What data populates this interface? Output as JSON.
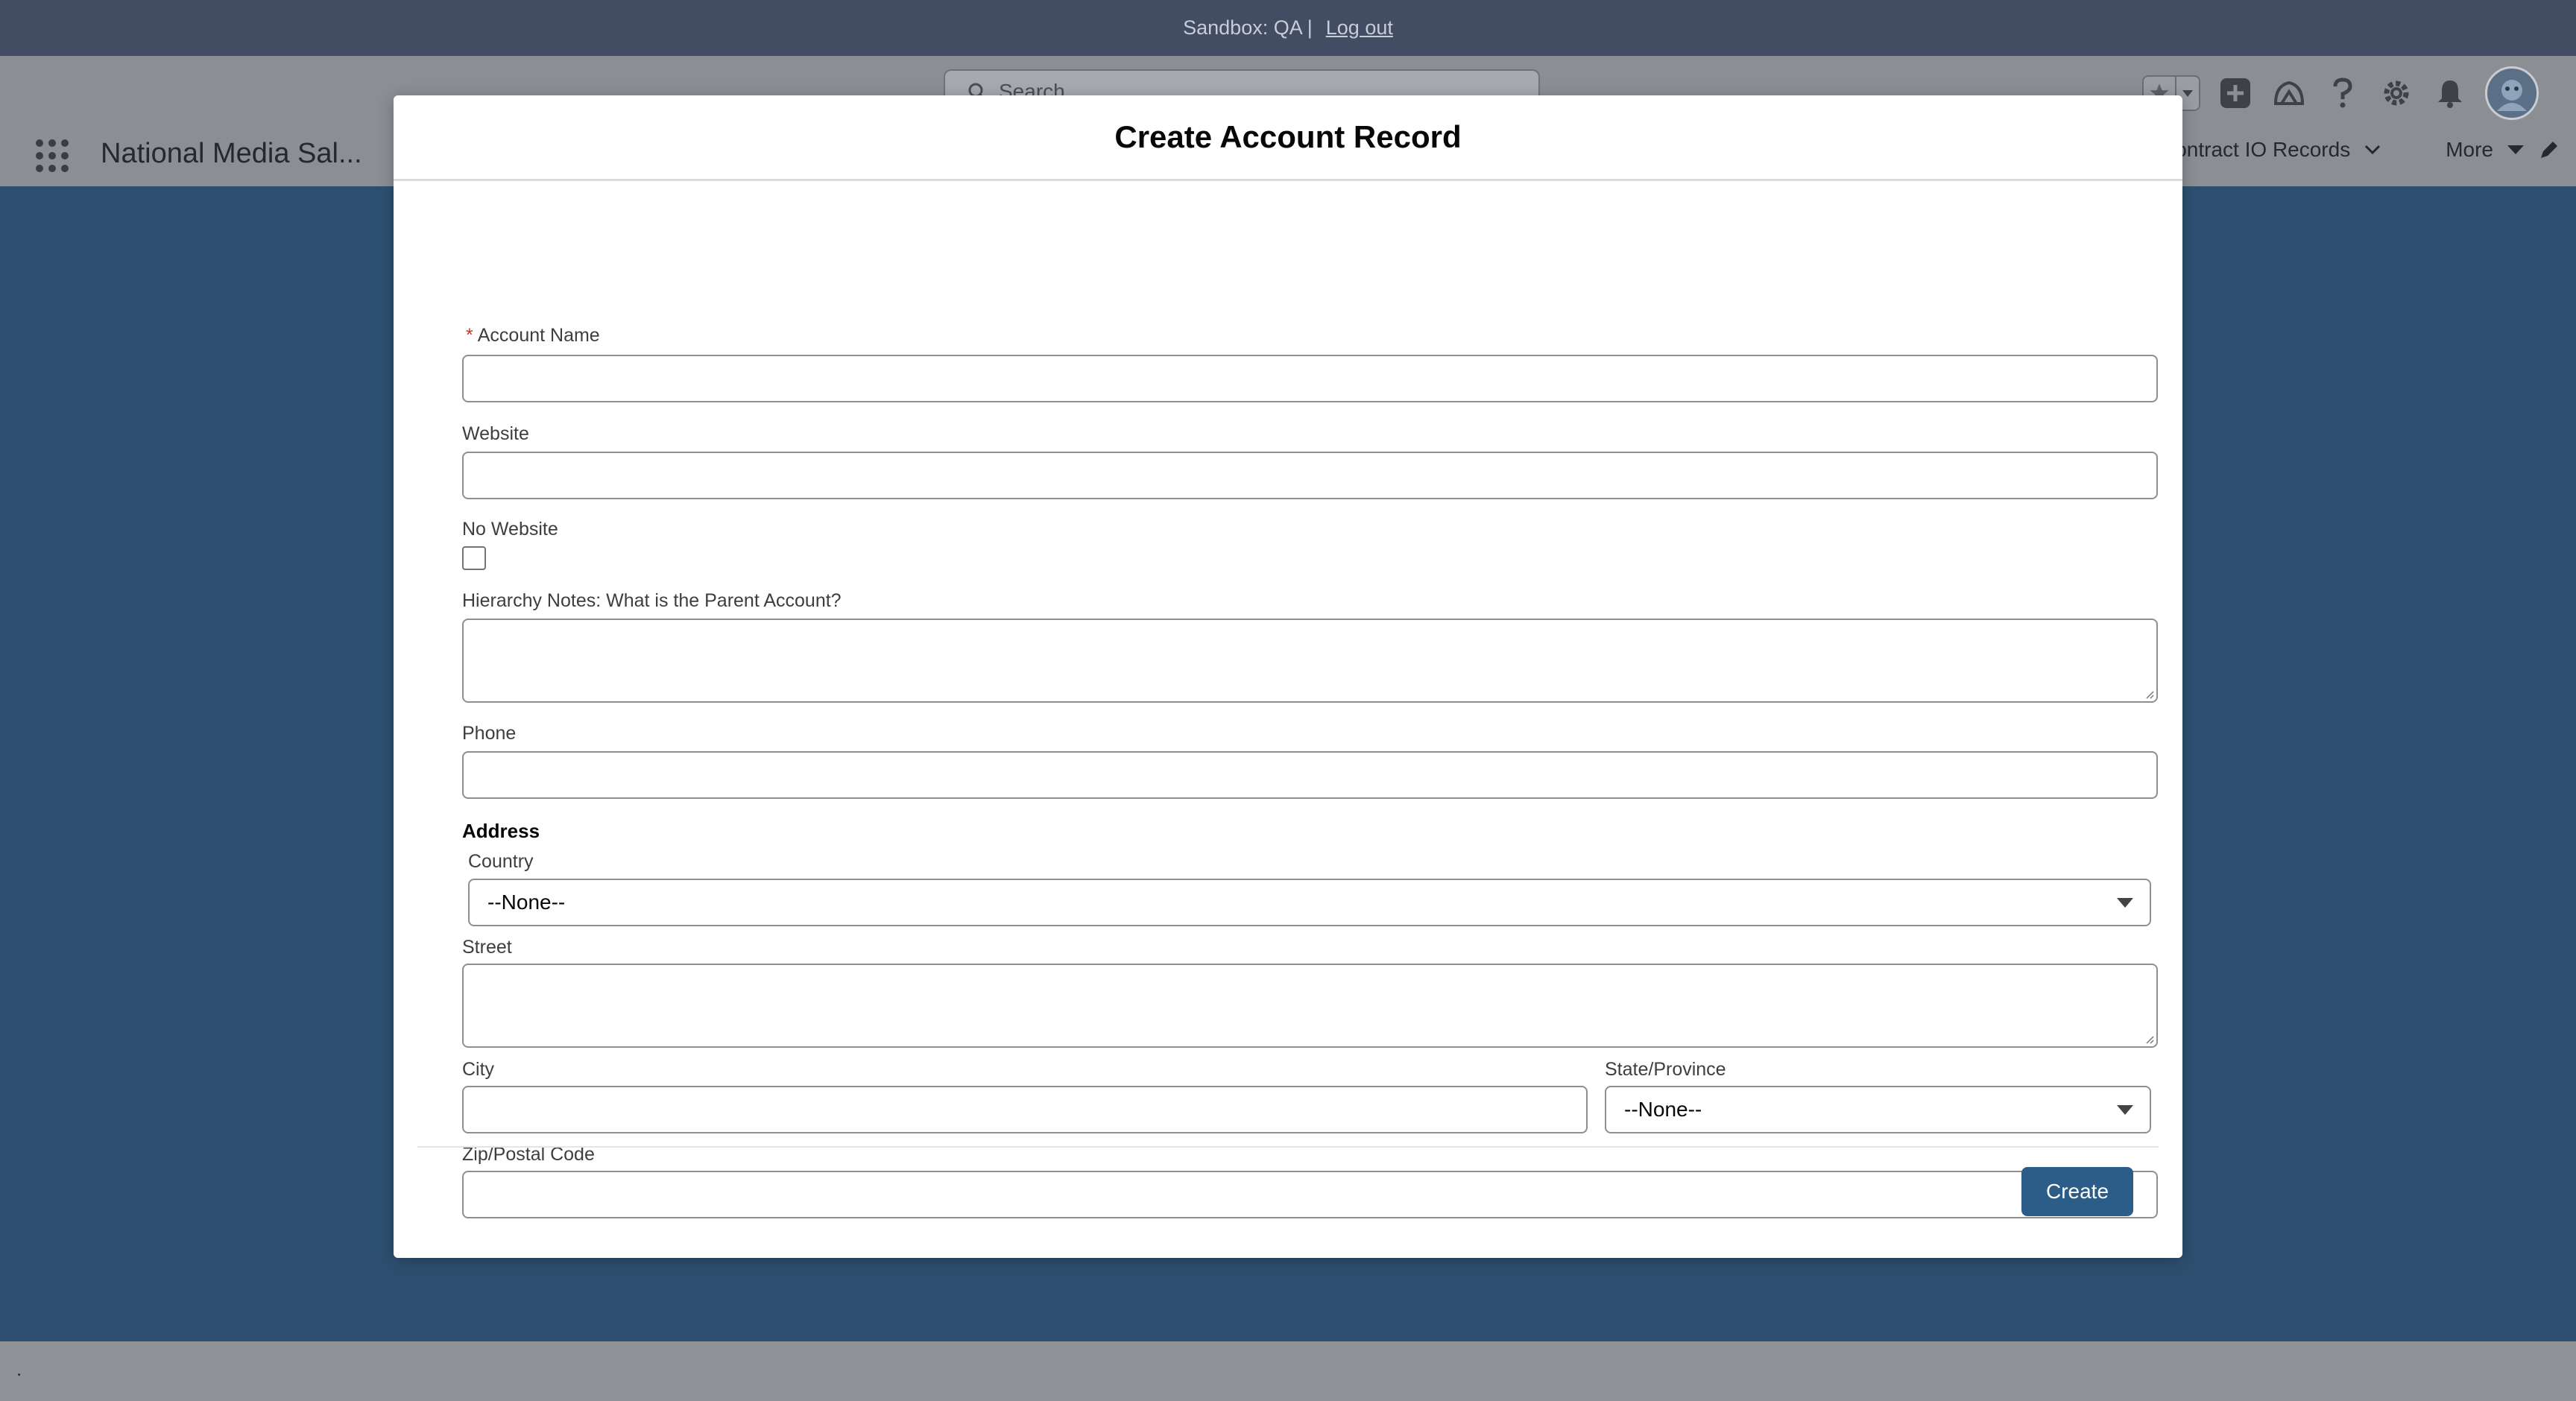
{
  "sandbox_bar": {
    "text": "Sandbox: QA |",
    "logout": "Log out"
  },
  "header": {
    "search_placeholder": "Search...",
    "icons": [
      "favorites-star-icon",
      "favorites-dropdown-icon",
      "global-actions-plus-icon",
      "trailhead-icon",
      "help-icon",
      "setup-gear-icon",
      "notifications-bell-icon",
      "user-avatar"
    ]
  },
  "nav": {
    "app_name": "National Media Sal...",
    "tab_contract": "Contract IO Records",
    "tab_more": "More"
  },
  "modal": {
    "title": "Create Account Record",
    "fields": {
      "account_name": {
        "label": "Account Name",
        "required_marker": "*",
        "value": ""
      },
      "website": {
        "label": "Website",
        "value": ""
      },
      "no_website": {
        "label": "No Website",
        "checked": false
      },
      "hierarchy_notes": {
        "label": "Hierarchy Notes: What is the Parent Account?",
        "value": ""
      },
      "phone": {
        "label": "Phone",
        "value": ""
      }
    },
    "address": {
      "title": "Address",
      "country": {
        "label": "Country",
        "selected": "--None--"
      },
      "street": {
        "label": "Street",
        "value": ""
      },
      "city": {
        "label": "City",
        "value": ""
      },
      "state": {
        "label": "State/Province",
        "selected": "--None--"
      },
      "zip": {
        "label": "Zip/Postal Code",
        "value": ""
      }
    },
    "create_label": "Create"
  },
  "footer": {
    "text": "."
  },
  "colors": {
    "sandbox_bar": "#424c63",
    "page_bg": "#2d5070",
    "brand_button": "#2c5d88",
    "required": "#c23934"
  }
}
